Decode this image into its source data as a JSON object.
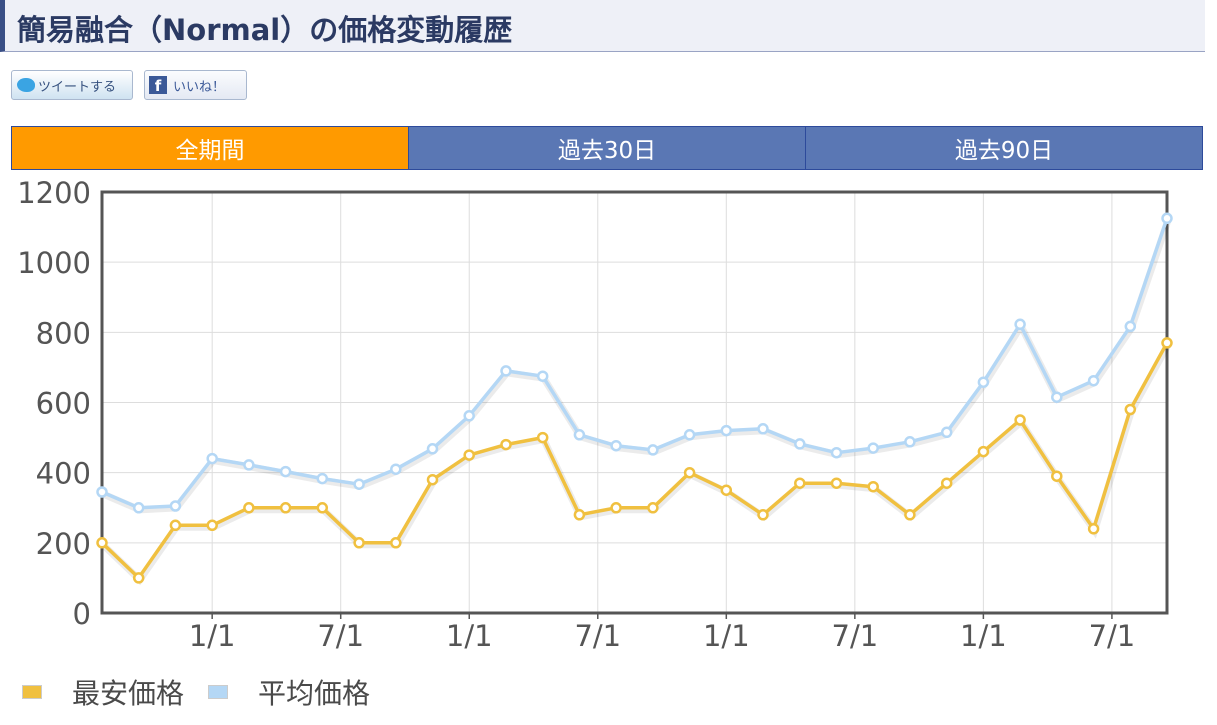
{
  "page": {
    "title": "簡易融合（Normal）の価格変動履歴"
  },
  "share": {
    "tweet_label": "ツイートする",
    "like_label": "いいね！"
  },
  "tabs": [
    {
      "label": "全期間",
      "active": true
    },
    {
      "label": "過去30日",
      "active": false
    },
    {
      "label": "過去90日",
      "active": false
    }
  ],
  "colors": {
    "active_tab": "#ff9a00",
    "tab": "#5a77b4",
    "min_price_line": "#f0c040",
    "avg_price_line": "#b4d7f5"
  },
  "chart_data": {
    "type": "line",
    "ylim": [
      0,
      1200
    ],
    "yticks": [
      0,
      200,
      400,
      600,
      800,
      1000,
      1200
    ],
    "x_tick_labels": [
      {
        "label": "1/1",
        "x": 3
      },
      {
        "label": "7/1",
        "x": 6.5
      },
      {
        "label": "1/1",
        "x": 10
      },
      {
        "label": "7/1",
        "x": 13.5
      },
      {
        "label": "1/1",
        "x": 17
      },
      {
        "label": "7/1",
        "x": 20.5
      },
      {
        "label": "1/1",
        "x": 24
      },
      {
        "label": "7/1",
        "x": 27.5
      }
    ],
    "xlim": [
      0,
      29
    ],
    "grid": true,
    "legend_position": "bottom-left",
    "series": [
      {
        "name": "最安価格",
        "color": "#f0c040",
        "values": [
          200,
          100,
          250,
          250,
          300,
          300,
          300,
          200,
          200,
          380,
          450,
          480,
          500,
          280,
          300,
          300,
          400,
          350,
          280,
          370,
          370,
          360,
          280,
          370,
          460,
          550,
          390,
          240,
          580,
          770
        ]
      },
      {
        "name": "平均価格",
        "color": "#b4d7f5",
        "values": [
          345,
          300,
          305,
          440,
          422,
          403,
          383,
          367,
          410,
          468,
          562,
          690,
          675,
          508,
          477,
          465,
          508,
          520,
          525,
          482,
          457,
          470,
          488,
          515,
          658,
          823,
          615,
          662,
          817,
          1125
        ]
      }
    ]
  }
}
